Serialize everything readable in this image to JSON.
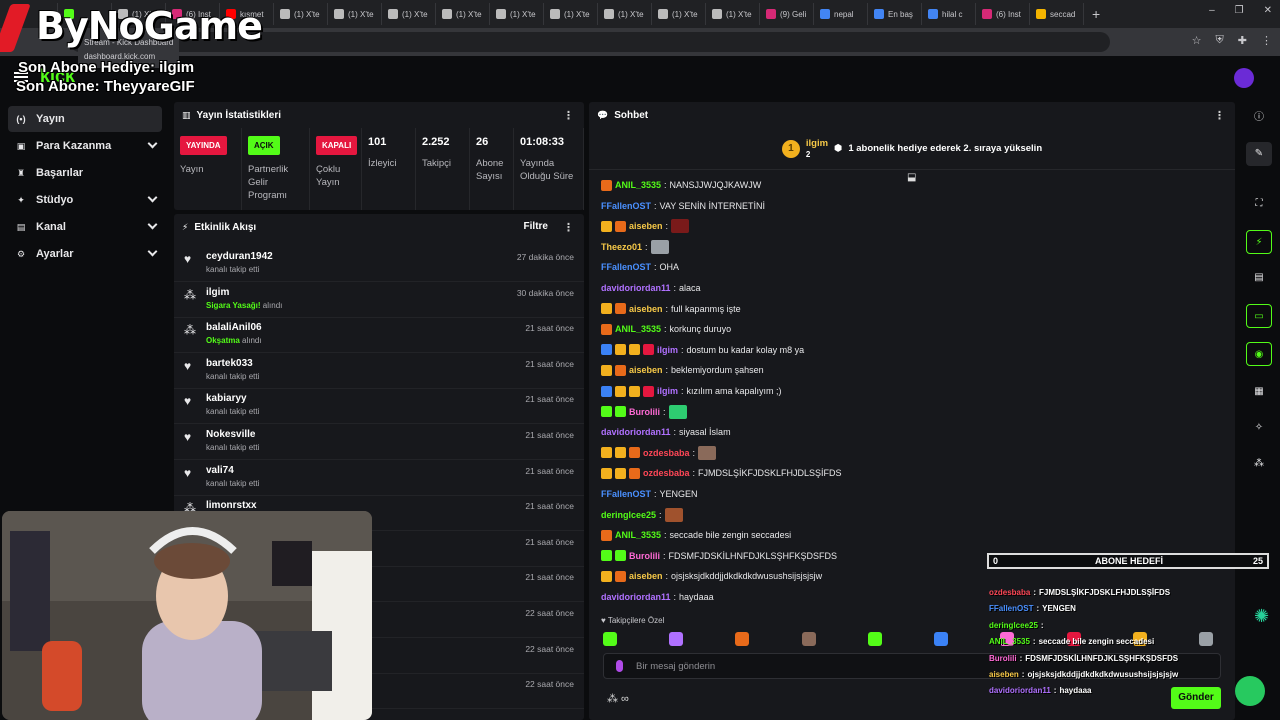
{
  "browser": {
    "tabs": [
      {
        "label": "",
        "color": "#e23b2e"
      },
      {
        "label": "",
        "color": "#53fc18"
      },
      {
        "label": "(1) X'te",
        "color": "#bbbbbb"
      },
      {
        "label": "(6) Inst",
        "color": "#d62976"
      },
      {
        "label": "kısmet",
        "color": "#ff0000"
      },
      {
        "label": "(1) X'te",
        "color": "#bbbbbb"
      },
      {
        "label": "(1) X'te",
        "color": "#bbbbbb"
      },
      {
        "label": "(1) X'te",
        "color": "#bbbbbb"
      },
      {
        "label": "(1) X'te",
        "color": "#bbbbbb"
      },
      {
        "label": "(1) X'te",
        "color": "#bbbbbb"
      },
      {
        "label": "(1) X'te",
        "color": "#bbbbbb"
      },
      {
        "label": "(1) X'te",
        "color": "#bbbbbb"
      },
      {
        "label": "(1) X'te",
        "color": "#bbbbbb"
      },
      {
        "label": "(1) X'te",
        "color": "#bbbbbb"
      },
      {
        "label": "(9) Geli",
        "color": "#d62976"
      },
      {
        "label": "nepal",
        "color": "#4285f4"
      },
      {
        "label": "En baş",
        "color": "#4285f4"
      },
      {
        "label": "hilal c",
        "color": "#4285f4"
      },
      {
        "label": "(6) Inst",
        "color": "#d62976"
      },
      {
        "label": "seccad",
        "color": "#f4b400"
      }
    ],
    "tooltip": {
      "title": "Stream - Kick Dashboard",
      "url": "dashboard.kick.com"
    }
  },
  "overlay": {
    "logo_text": "ByNoGame",
    "last_sub_gift": "Son Abone Hediye: ilgim",
    "last_sub": "Son Abone: TheyyareGIF"
  },
  "header": {
    "logo": "kick"
  },
  "sidebar": {
    "items": [
      {
        "label": "Yayın",
        "icon": "broadcast-icon",
        "glyph": "(•)",
        "expandable": false,
        "active": true
      },
      {
        "label": "Para Kazanma",
        "icon": "money-icon",
        "glyph": "▣",
        "expandable": true,
        "active": false
      },
      {
        "label": "Başarılar",
        "icon": "trophy-icon",
        "glyph": "♜",
        "expandable": false,
        "active": false
      },
      {
        "label": "Stüdyo",
        "icon": "studio-icon",
        "glyph": "✦",
        "expandable": true,
        "active": false
      },
      {
        "label": "Kanal",
        "icon": "channel-icon",
        "glyph": "▤",
        "expandable": true,
        "active": false
      },
      {
        "label": "Ayarlar",
        "icon": "settings-icon",
        "glyph": "⚙",
        "expandable": true,
        "active": false
      }
    ]
  },
  "stats": {
    "title": "Yayın İstatistikleri",
    "cols": [
      {
        "badge": "YAYINDA",
        "badge_color": "#e5173f",
        "label": "Yayın"
      },
      {
        "badge": "AÇIK",
        "badge_color": "#53fc18",
        "label": "Partnerlik Gelir Programı"
      },
      {
        "badge": "KAPALI",
        "badge_color": "#e5173f",
        "label": "Çoklu Yayın"
      },
      {
        "value": "101",
        "label": "İzleyici"
      },
      {
        "value": "2.252",
        "label": "Takipçi"
      },
      {
        "value": "26",
        "label": "Abone Sayısı"
      },
      {
        "value": "01:08:33",
        "label": "Yayında Olduğu Süre"
      }
    ]
  },
  "activity": {
    "title": "Etkinlik Akışı",
    "filter": "Filtre",
    "items": [
      {
        "name": "ceyduran1942",
        "sub": "kanalı takip etti",
        "highlight": "",
        "time": "27 dakika önce",
        "icon": "heart-icon"
      },
      {
        "name": "ilgim",
        "sub": "alındı",
        "highlight": "Sigara Yasağı!",
        "time": "30 dakika önce",
        "icon": "gift-icon"
      },
      {
        "name": "balaliAnil06",
        "sub": "alındı",
        "highlight": "Okşatma",
        "time": "21 saat önce",
        "icon": "gift-icon"
      },
      {
        "name": "bartek033",
        "sub": "kanalı takip etti",
        "highlight": "",
        "time": "21 saat önce",
        "icon": "heart-icon"
      },
      {
        "name": "kabiaryy",
        "sub": "kanalı takip etti",
        "highlight": "",
        "time": "21 saat önce",
        "icon": "heart-icon"
      },
      {
        "name": "Nokesville",
        "sub": "kanalı takip etti",
        "highlight": "",
        "time": "21 saat önce",
        "icon": "heart-icon"
      },
      {
        "name": "vali74",
        "sub": "kanalı takip etti",
        "highlight": "",
        "time": "21 saat önce",
        "icon": "heart-icon"
      },
      {
        "name": "limonrstxx",
        "sub": "",
        "highlight": "",
        "time": "21 saat önce",
        "icon": "gift-icon"
      },
      {
        "name": "",
        "sub": "",
        "highlight": "",
        "time": "21 saat önce",
        "icon": "heart-icon"
      },
      {
        "name": "",
        "sub": "",
        "highlight": "",
        "time": "21 saat önce",
        "icon": "heart-icon"
      },
      {
        "name": "",
        "sub": "",
        "highlight": "",
        "time": "22 saat önce",
        "icon": "heart-icon"
      },
      {
        "name": "",
        "sub": "",
        "highlight": "",
        "time": "22 saat önce",
        "icon": "heart-icon"
      },
      {
        "name": "",
        "sub": "",
        "highlight": "",
        "time": "22 saat önce",
        "icon": "heart-icon"
      }
    ]
  },
  "chat": {
    "title": "Sohbet",
    "banner": {
      "rank": "1",
      "user": "ilgim",
      "count": "2",
      "message": "1 abonelik hediye ederek 2. sıraya yükselin"
    },
    "messages": [
      {
        "user": "ANIL_3535",
        "color": "#53fc18",
        "badges": [
          "#e86a1a"
        ],
        "text": "NANSJJWJQJKAWJW",
        "emote": ""
      },
      {
        "user": "FFallenOST",
        "color": "#4a90ff",
        "badges": [],
        "text": "VAY SENİN İNTERNETİNİ",
        "emote": ""
      },
      {
        "user": "aiseben",
        "color": "#f7c948",
        "badges": [
          "#f2b01e",
          "#e86a1a"
        ],
        "text": "",
        "emote": "#7a1a1a"
      },
      {
        "user": "Theezo01",
        "color": "#f7c948",
        "badges": [],
        "text": "",
        "emote": "#9aa0a6"
      },
      {
        "user": "FFallenOST",
        "color": "#4a90ff",
        "badges": [],
        "text": "OHA",
        "emote": ""
      },
      {
        "user": "davidoriordan11",
        "color": "#b071ff",
        "badges": [],
        "text": "alaca",
        "emote": ""
      },
      {
        "user": "aiseben",
        "color": "#f7c948",
        "badges": [
          "#f2b01e",
          "#e86a1a"
        ],
        "text": "full kapanmış işte",
        "emote": ""
      },
      {
        "user": "ANIL_3535",
        "color": "#53fc18",
        "badges": [
          "#e86a1a"
        ],
        "text": "korkunç duruyo",
        "emote": ""
      },
      {
        "user": "ilgim",
        "color": "#b071ff",
        "badges": [
          "#3b82f6",
          "#f2b01e",
          "#f2b01e",
          "#e5173f"
        ],
        "text": "dostum bu kadar kolay m8 ya",
        "emote": ""
      },
      {
        "user": "aiseben",
        "color": "#f7c948",
        "badges": [
          "#f2b01e",
          "#e86a1a"
        ],
        "text": "beklemiyordum şahsen",
        "emote": ""
      },
      {
        "user": "ilgim",
        "color": "#b071ff",
        "badges": [
          "#3b82f6",
          "#f2b01e",
          "#f2b01e",
          "#e5173f"
        ],
        "text": "kızılım ama kapalıyım ;)",
        "emote": ""
      },
      {
        "user": "Burolili",
        "color": "#ff6ad5",
        "badges": [
          "#53fc18",
          "#53fc18"
        ],
        "text": "",
        "emote": "#2ecc71"
      },
      {
        "user": "davidoriordan11",
        "color": "#b071ff",
        "badges": [],
        "text": "siyasal İslam",
        "emote": ""
      },
      {
        "user": "ozdesbaba",
        "color": "#ff4757",
        "badges": [
          "#f2b01e",
          "#f2b01e",
          "#e86a1a"
        ],
        "text": "",
        "emote": "#8a6a5a"
      },
      {
        "user": "ozdesbaba",
        "color": "#ff4757",
        "badges": [
          "#f2b01e",
          "#f2b01e",
          "#e86a1a"
        ],
        "text": "FJMDSLŞİKFJDSKLFHJDLSŞİFDS",
        "emote": ""
      },
      {
        "user": "FFallenOST",
        "color": "#4a90ff",
        "badges": [],
        "text": "YENGEN",
        "emote": ""
      },
      {
        "user": "deringlcee25",
        "color": "#53fc18",
        "badges": [],
        "text": "",
        "emote": "#a0522d"
      },
      {
        "user": "ANIL_3535",
        "color": "#53fc18",
        "badges": [
          "#e86a1a"
        ],
        "text": "seccade bile zengin seccadesi",
        "emote": ""
      },
      {
        "user": "Burolili",
        "color": "#ff6ad5",
        "badges": [
          "#53fc18",
          "#53fc18"
        ],
        "text": "FDSMFJDSKİLHNFDJKLSŞHFKŞDSFDS",
        "emote": ""
      },
      {
        "user": "aiseben",
        "color": "#f7c948",
        "badges": [
          "#f2b01e",
          "#e86a1a"
        ],
        "text": "ojsjsksjdkddjjdkdkdkdwusushsijsjsjsjw",
        "emote": ""
      },
      {
        "user": "davidoriordan11",
        "color": "#b071ff",
        "badges": [],
        "text": "haydaaa",
        "emote": ""
      }
    ],
    "followers_label": "Takipçilere Özel",
    "emotes": [
      "#53fc18",
      "#b071ff",
      "#e86a1a",
      "#8a6a5a",
      "#53fc18",
      "#3b82f6",
      "#ff6ad5",
      "#e5173f",
      "#f2b01e",
      "#9aa0a6"
    ],
    "input_placeholder": "Bir mesaj gönderin",
    "send_label": "Gönder"
  },
  "goal": {
    "left": "0",
    "label": "ABONE HEDEFİ",
    "right": "25"
  },
  "chat_overlay": [
    {
      "user": "ozdesbaba",
      "color": "#ff4757",
      "text": "FJMDSLŞİKFJDSKLFHJDLSŞİFDS"
    },
    {
      "user": "FFallenOST",
      "color": "#4a90ff",
      "text": "YENGEN"
    },
    {
      "user": "deringlcee25",
      "color": "#53fc18",
      "text": ""
    },
    {
      "user": "ANIL_3535",
      "color": "#53fc18",
      "text": "seccade bile zengin seccadesi"
    },
    {
      "user": "Burolili",
      "color": "#ff6ad5",
      "text": "FDSMFJDSKİLHNFDJKLSŞHFKŞDSFDS"
    },
    {
      "user": "aiseben",
      "color": "#f7c948",
      "text": "ojsjsksjdkddjjdkdkdkdwusushsijsjsjsjw"
    },
    {
      "user": "davidoriordan11",
      "color": "#b071ff",
      "text": "haydaaa"
    }
  ]
}
